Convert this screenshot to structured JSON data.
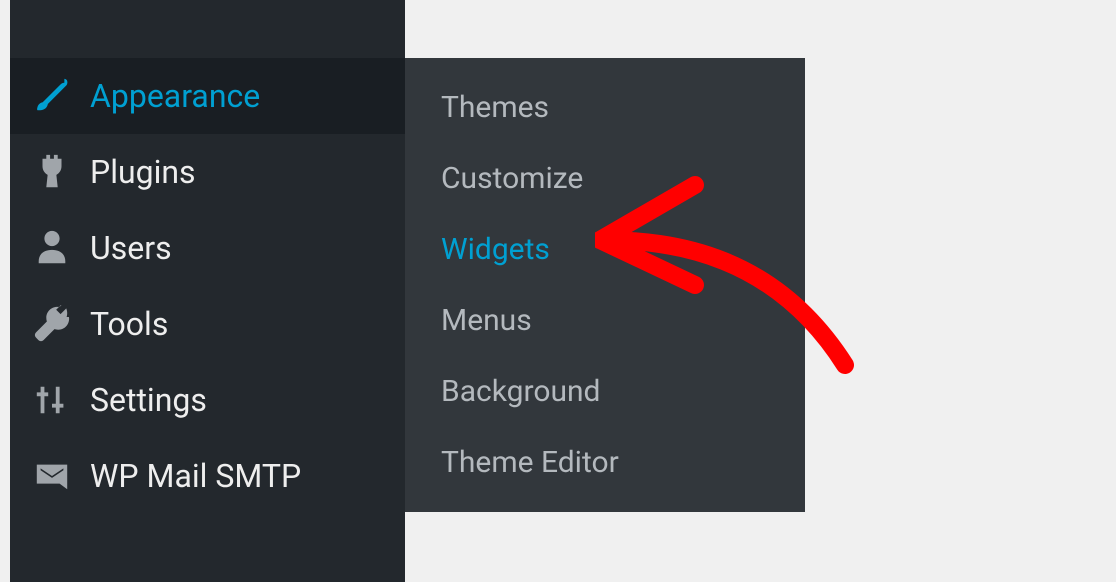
{
  "sidebar": {
    "items": [
      {
        "label": "Appearance",
        "icon": "paintbrush-icon",
        "active": true
      },
      {
        "label": "Plugins",
        "icon": "plug-icon",
        "active": false
      },
      {
        "label": "Users",
        "icon": "user-icon",
        "active": false
      },
      {
        "label": "Tools",
        "icon": "wrench-icon",
        "active": false
      },
      {
        "label": "Settings",
        "icon": "sliders-icon",
        "active": false
      },
      {
        "label": "WP Mail SMTP",
        "icon": "mail-icon",
        "active": false
      }
    ]
  },
  "submenu": {
    "items": [
      {
        "label": "Themes",
        "highlighted": false
      },
      {
        "label": "Customize",
        "highlighted": false
      },
      {
        "label": "Widgets",
        "highlighted": true
      },
      {
        "label": "Menus",
        "highlighted": false
      },
      {
        "label": "Background",
        "highlighted": false
      },
      {
        "label": "Theme Editor",
        "highlighted": false
      }
    ]
  },
  "colors": {
    "sidebar_bg": "#23282d",
    "sidebar_active_bg": "#191e23",
    "submenu_bg": "#32373c",
    "accent": "#00a0d2",
    "text": "#eeeeee",
    "submenu_text": "#b4b9be",
    "annotation": "#ff0000"
  }
}
